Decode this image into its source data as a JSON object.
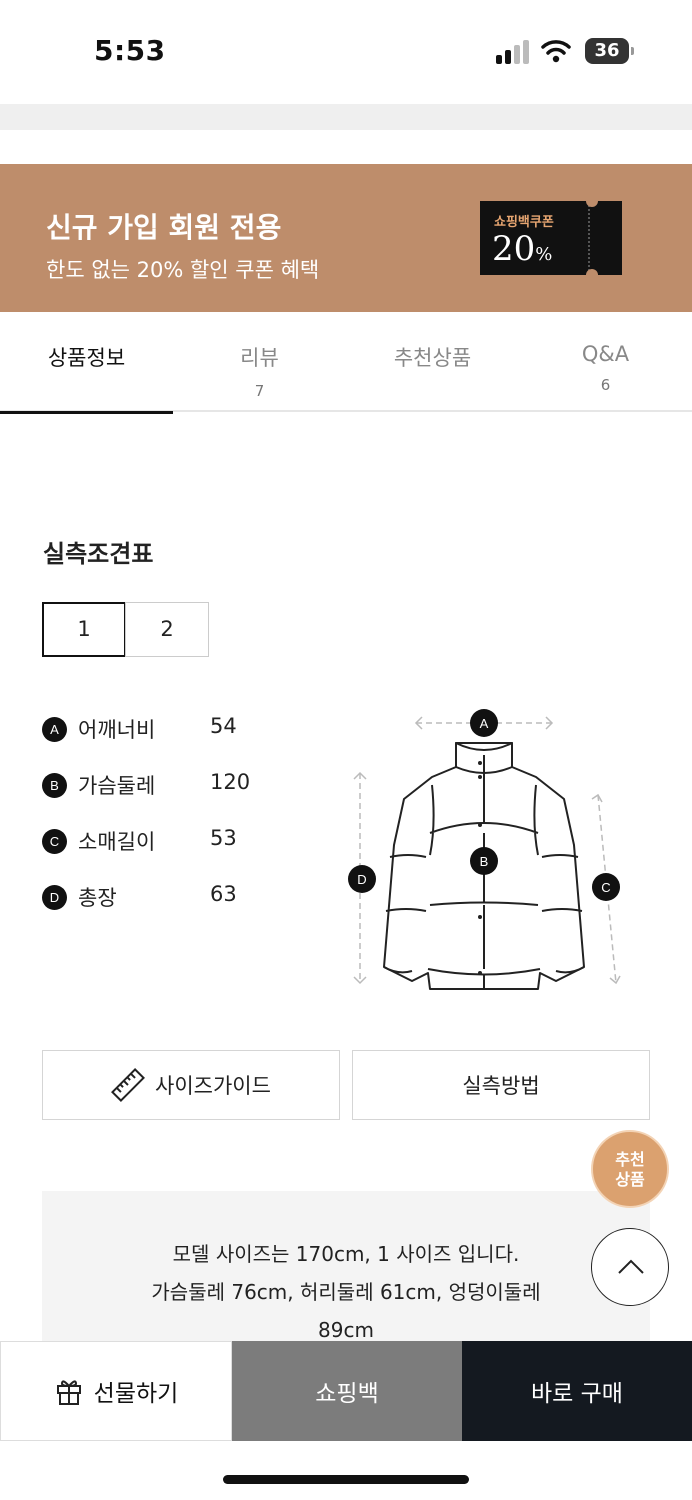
{
  "status_bar": {
    "time": "5:53",
    "battery": "36"
  },
  "banner": {
    "title": "신규 가입 회원 전용",
    "subtitle": "한도 없는 20% 할인 쿠폰 혜택",
    "coupon_label": "쇼핑백쿠폰",
    "coupon_value": "20",
    "coupon_unit": "%"
  },
  "tabs": [
    {
      "label": "상품정보",
      "count": "",
      "active": true
    },
    {
      "label": "리뷰",
      "count": "7"
    },
    {
      "label": "추천상품",
      "count": ""
    },
    {
      "label": "Q&A",
      "count": "6"
    }
  ],
  "size_section": {
    "title": "실측조견표",
    "size_tabs": [
      "1",
      "2"
    ],
    "measurements": [
      {
        "key": "A",
        "name": "어깨너비",
        "value": "54"
      },
      {
        "key": "B",
        "name": "가슴둘레",
        "value": "120"
      },
      {
        "key": "C",
        "name": "소매길이",
        "value": "53"
      },
      {
        "key": "D",
        "name": "총장",
        "value": "63"
      }
    ],
    "diagram_markers": [
      "A",
      "B",
      "C",
      "D"
    ]
  },
  "buttons": {
    "size_guide": "사이즈가이드",
    "measure_method": "실측방법"
  },
  "model_info": {
    "line1": "모델 사이즈는 170cm, 1 사이즈 입니다.",
    "line2": "가슴둘레 76cm, 허리둘레 61cm, 엉덩이둘레",
    "line3": "89cm"
  },
  "floating": {
    "recommend_line1": "추천",
    "recommend_line2": "상품"
  },
  "bottom_bar": {
    "gift": "선물하기",
    "bag": "쇼핑백",
    "buy": "바로 구매"
  },
  "colors": {
    "banner": "#be8d6b",
    "coupon_bg": "#111111",
    "recommend": "#dba16f",
    "buy_bg": "#141920",
    "bag_bg": "#7c7c7c"
  }
}
